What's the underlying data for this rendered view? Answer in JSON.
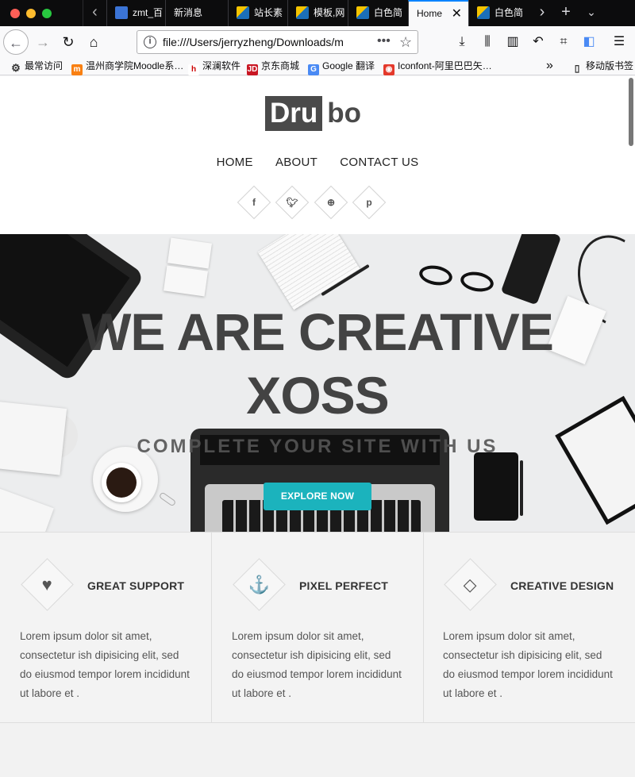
{
  "browser": {
    "tabs": [
      {
        "label": "zmt_百",
        "icon": "paw-icon"
      },
      {
        "label": "新消息",
        "icon": ""
      },
      {
        "label": "站长素",
        "icon": "blog-icon"
      },
      {
        "label": "模板,网",
        "icon": "blog-icon"
      },
      {
        "label": "白色简",
        "icon": "blog-icon"
      },
      {
        "label": "Home",
        "icon": "",
        "active": true
      },
      {
        "label": "白色简",
        "icon": "blog-icon"
      }
    ],
    "url": "file:///Users/jerryzheng/Downloads/m",
    "bookmarks": [
      {
        "label": "最常访问",
        "icon": "gear-icon"
      },
      {
        "label": "温州商学院Moodle系…",
        "icon": "moodle-icon"
      },
      {
        "label": "深澜软件",
        "icon": "h-icon"
      },
      {
        "label": "京东商城",
        "icon": "jd-icon"
      },
      {
        "label": "Google 翻译",
        "icon": "translate-icon"
      },
      {
        "label": "Iconfont-阿里巴巴矢…",
        "icon": "iconfont-icon"
      }
    ],
    "mobile_bookmarks": "移动版书签"
  },
  "site": {
    "logo": {
      "part1": "Dru",
      "part2": "bo"
    },
    "menu": [
      "HOME",
      "ABOUT",
      "CONTACT US"
    ],
    "social": [
      "f",
      "t",
      "d",
      "p"
    ]
  },
  "hero": {
    "title_line1": "WE ARE CREATIVE",
    "title_line2": "XOSS",
    "subtitle": "COMPLETE YOUR SITE WITH US",
    "button": "EXPLORE NOW"
  },
  "features": [
    {
      "icon": "heart-icon",
      "glyph": "♥",
      "title": "GREAT SUPPORT",
      "text": "Lorem ipsum dolor sit amet, consectetur ish dipisicing elit, sed do eiusmod tempor lorem incididunt ut labore et ."
    },
    {
      "icon": "anchor-icon",
      "glyph": "⚓",
      "title": "PIXEL PERFECT",
      "text": "Lorem ipsum dolor sit amet, consectetur ish dipisicing elit, sed do eiusmod tempor lorem incididunt ut labore et ."
    },
    {
      "icon": "diamond-icon",
      "glyph": "◇",
      "title": "CREATIVE DESIGN",
      "text": "Lorem ipsum dolor sit amet, consectetur ish dipisicing elit, sed do eiusmod tempor lorem incididunt ut labore et ."
    }
  ],
  "colors": {
    "accent": "#1bb3bd",
    "logo": "#4a4a4a",
    "tab_active_border": "#0a84ff"
  }
}
